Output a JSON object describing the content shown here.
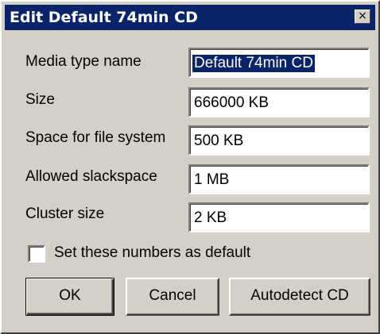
{
  "window": {
    "title": "Edit Default 74min CD",
    "close_glyph": "×"
  },
  "form": {
    "media_type_label": "Media type name",
    "media_type_value": "Default 74min CD",
    "size_label": "Size",
    "size_value": "666000 KB",
    "fs_space_label": "Space for file system",
    "fs_space_value": "500 KB",
    "slack_label": "Allowed slackspace",
    "slack_value": "1 MB",
    "cluster_label": "Cluster size",
    "cluster_value": "2 KB",
    "default_checkbox_label": "Set these numbers as default",
    "default_checkbox_checked": false
  },
  "buttons": {
    "ok": "OK",
    "cancel": "Cancel",
    "autodetect": "Autodetect CD"
  },
  "colors": {
    "titlebar": "#0a246a",
    "face": "#d4d0c8",
    "selection": "#0a246a"
  }
}
